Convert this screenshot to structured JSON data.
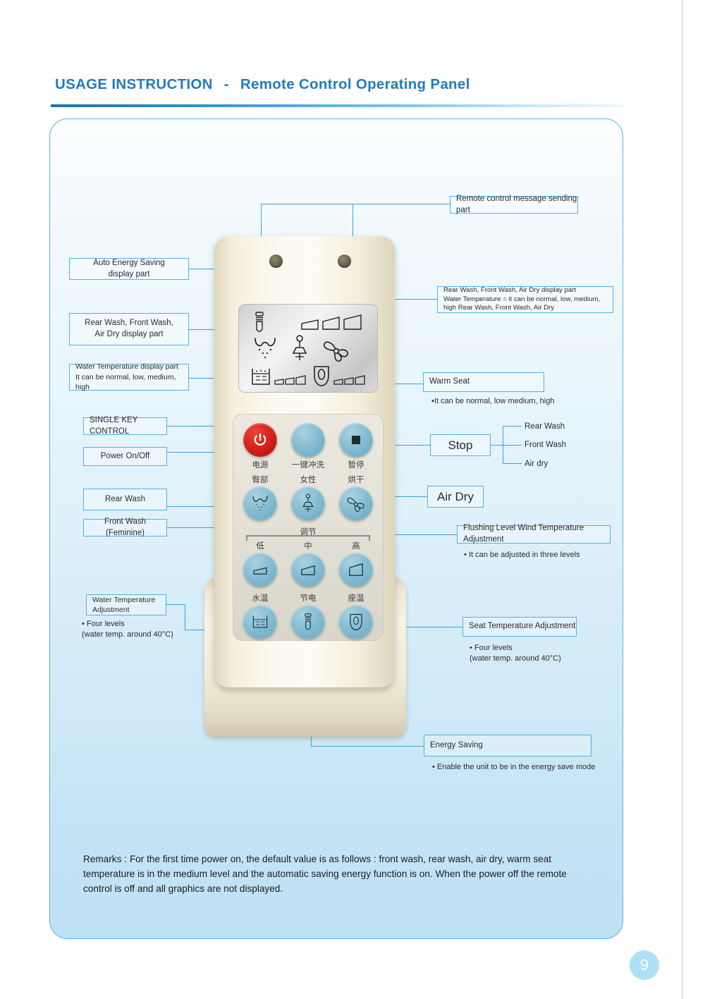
{
  "header": {
    "title_main": "USAGE INSTRUCTION",
    "dash": "-",
    "title_sub": "Remote Control Operating Panel"
  },
  "page": {
    "number": "9"
  },
  "callouts": {
    "top_sender": "Remote control message sending part",
    "auto_energy": "Auto Energy Saving\ndisplay part",
    "wash_display": "Rear Wash, Front Wash,\nAir Dry display part",
    "water_temp_display": "Water Temperature display part\nIt can be normal, low, medium, high",
    "right_display": "Rear Wash, Front Wash, Air Dry display part\nWater Temperature = it can be normal, low, medium,\nhigh Rear Wash, Front Wash, Air Dry",
    "warm_seat": "Warm Seat",
    "warm_seat_note": "▪It can be normal, low medium, high",
    "single_key": "SINGLE KEY CONTROL",
    "power": "Power On/Off",
    "rear_wash": "Rear Wash",
    "front_wash": "Front Wash (Feminine)",
    "stop": "Stop",
    "stop_branch_1": "Rear Wash",
    "stop_branch_2": "Front Wash",
    "stop_branch_3": "Air dry",
    "air_dry": "Air Dry",
    "flushing": "Flushing Level Wind Temperature Adjustment",
    "flushing_note": "• It can be adjusted in three levels",
    "water_temp_adj": "Water Temperature\nAdjustment",
    "water_temp_note": "• Four levels\n  (water temp. around 40°C)",
    "seat_temp_adj": "Seat Temperature Adjustment",
    "seat_temp_note": "• Four levels\n     (water temp. around 40°C)",
    "energy_saving": "Energy Saving",
    "energy_saving_note": "• Enable the unit to be in the energy save mode"
  },
  "remote": {
    "keys": [
      {
        "cn": "电源",
        "en": "Power On/Off",
        "icon": "power-icon"
      },
      {
        "cn": "一键冲洗",
        "en": "Single Key Control",
        "icon": "single-key-icon"
      },
      {
        "cn": "暂停",
        "en": "Stop",
        "icon": "stop-icon"
      },
      {
        "cn": "臀部",
        "en": "Rear Wash",
        "icon": "rear-wash-icon"
      },
      {
        "cn": "女性",
        "en": "Front Wash Feminine",
        "icon": "feminine-icon"
      },
      {
        "cn": "烘干",
        "en": "Air Dry",
        "icon": "fan-icon"
      },
      {
        "cn": "低",
        "en": "Low",
        "icon": "level-low-icon"
      },
      {
        "cn": "中",
        "en": "Medium",
        "icon": "level-medium-icon"
      },
      {
        "cn": "高",
        "en": "High",
        "icon": "level-high-icon"
      },
      {
        "cn": "水温",
        "en": "Water Temperature",
        "icon": "water-temp-icon"
      },
      {
        "cn": "节电",
        "en": "Energy Saving",
        "icon": "energy-save-icon"
      },
      {
        "cn": "座温",
        "en": "Seat Temperature",
        "icon": "seat-temp-icon"
      }
    ],
    "adjust_label": "调节"
  },
  "remarks": {
    "label": "Remarks :",
    "text": "For the first time power on, the default value is as follows : front wash, rear wash, air dry, warm seat temperature is in the medium level and the automatic saving energy function is on.  When the power off the remote control is off and all graphics are not displayed."
  },
  "colors": {
    "accent": "#1f7bc1",
    "line": "#3ba3d6",
    "panel_border": "#59b3e0",
    "button": "#84bcd2",
    "power_button": "#d8241c",
    "page_badge": "#ade0f4"
  }
}
